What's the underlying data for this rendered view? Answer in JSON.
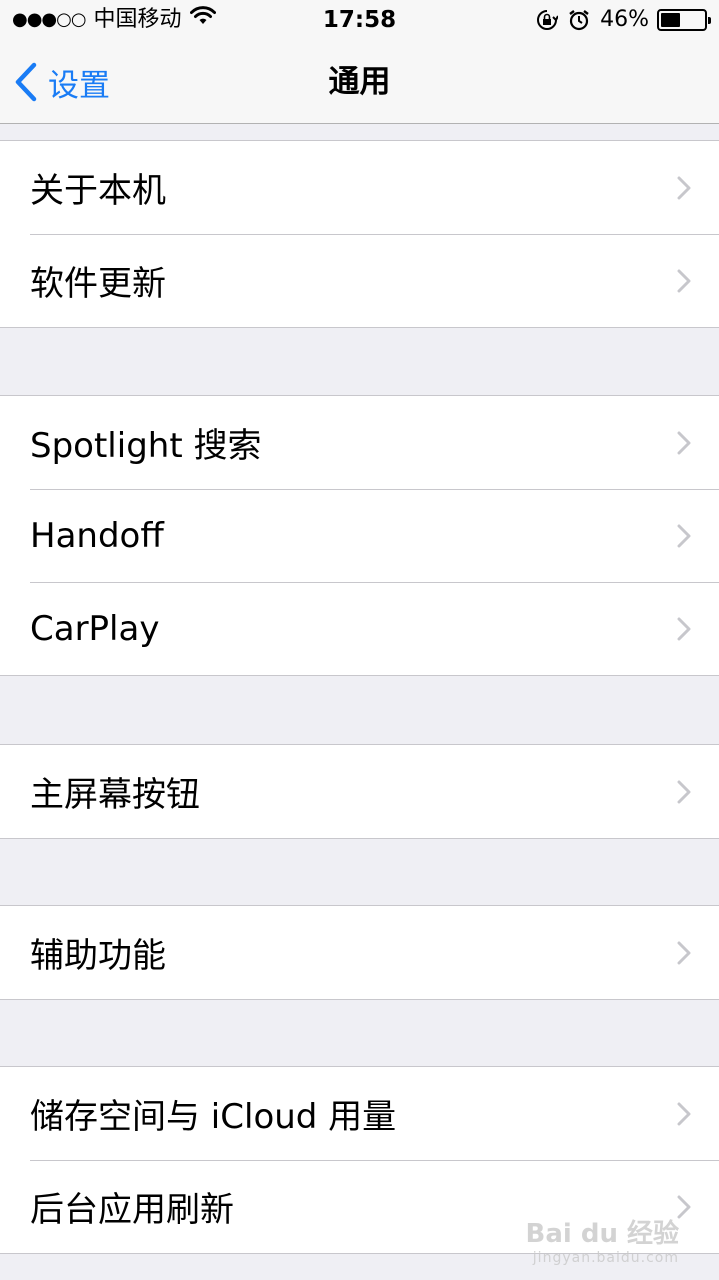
{
  "status_bar": {
    "signal": "●●●○○",
    "carrier": "中国移动",
    "time": "17:58",
    "battery_percent": "46%",
    "battery_level": 0.46,
    "icons": [
      "wifi-icon",
      "rotation-lock-icon",
      "alarm-icon",
      "battery-icon"
    ]
  },
  "nav": {
    "back_label": "设置",
    "title": "通用"
  },
  "groups": [
    {
      "rows": [
        {
          "label": "关于本机"
        },
        {
          "label": "软件更新"
        }
      ]
    },
    {
      "rows": [
        {
          "label": "Spotlight 搜索"
        },
        {
          "label": "Handoff"
        },
        {
          "label": "CarPlay"
        }
      ]
    },
    {
      "rows": [
        {
          "label": "主屏幕按钮"
        }
      ]
    },
    {
      "rows": [
        {
          "label": "辅助功能"
        }
      ]
    },
    {
      "rows": [
        {
          "label": "储存空间与 iCloud 用量"
        },
        {
          "label": "后台应用刷新"
        }
      ]
    }
  ],
  "watermark": {
    "brand": "Bai du 经验",
    "url": "jingyan.baidu.com"
  },
  "colors": {
    "accent": "#1a7cf5",
    "background": "#efeff4",
    "separator": "#c8c7cc",
    "chevron": "#c7c7cc"
  }
}
